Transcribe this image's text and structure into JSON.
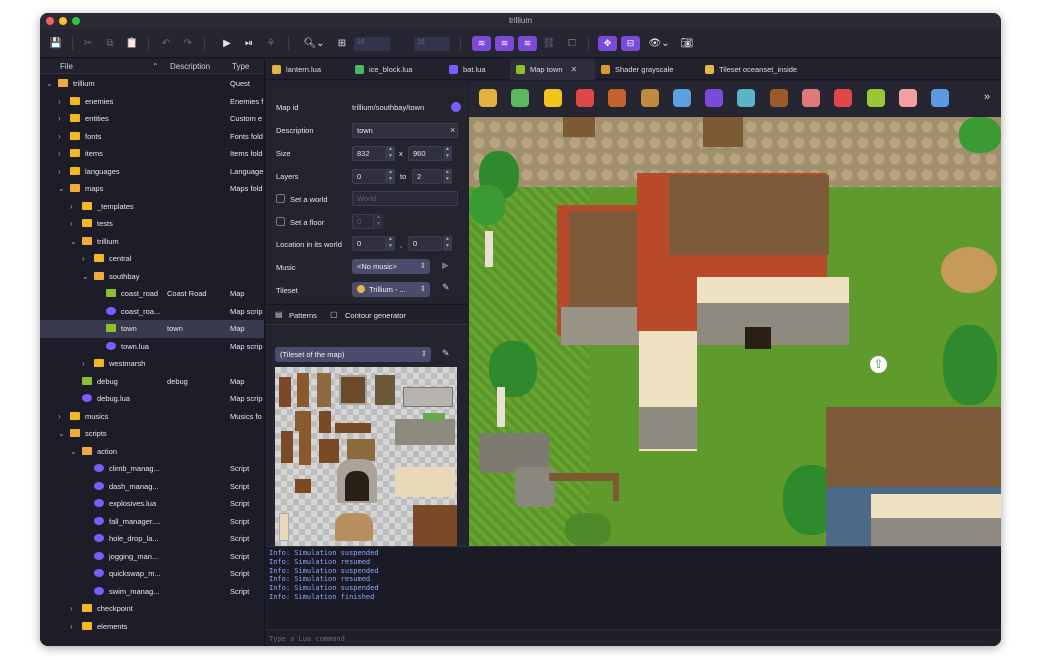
{
  "window": {
    "title": "trillium"
  },
  "toolbar": {
    "grid_w": "16",
    "grid_h": "16",
    "icons": [
      "save-icon",
      "cut-icon",
      "copy-icon",
      "paste-icon",
      "undo-icon",
      "redo-icon",
      "play-icon",
      "play-from-icon",
      "test-icon",
      "zoom-icon",
      "grid-icon",
      "layer-1-icon",
      "layer-2-icon",
      "layer-3-icon",
      "link-icon",
      "unlink-icon",
      "move-icon",
      "resize-icon",
      "view-icon",
      "screenshot-icon"
    ]
  },
  "tree": {
    "headers": {
      "file": "File",
      "description": "Description",
      "type": "Type"
    },
    "rows": [
      {
        "name": "trillium",
        "desc": "",
        "type": "Quest",
        "icon": "quest",
        "level": 0,
        "chev": "v"
      },
      {
        "name": "enemies",
        "desc": "",
        "type": "Enemies f",
        "icon": "folder",
        "level": 1,
        "chev": ">"
      },
      {
        "name": "entities",
        "desc": "",
        "type": "Custom e",
        "icon": "folder",
        "level": 1,
        "chev": ">"
      },
      {
        "name": "fonts",
        "desc": "",
        "type": "Fonts fold",
        "icon": "folder",
        "level": 1,
        "chev": ">"
      },
      {
        "name": "items",
        "desc": "",
        "type": "Items fold",
        "icon": "folder",
        "level": 1,
        "chev": ">"
      },
      {
        "name": "languages",
        "desc": "",
        "type": "Language",
        "icon": "folder",
        "level": 1,
        "chev": ">"
      },
      {
        "name": "maps",
        "desc": "",
        "type": "Maps fold",
        "icon": "folder-open",
        "level": 1,
        "chev": "v"
      },
      {
        "name": "_templates",
        "desc": "",
        "type": "",
        "icon": "folder",
        "level": 2,
        "chev": ">"
      },
      {
        "name": "tests",
        "desc": "",
        "type": "",
        "icon": "folder",
        "level": 2,
        "chev": ">"
      },
      {
        "name": "trillium",
        "desc": "",
        "type": "",
        "icon": "folder-open",
        "level": 2,
        "chev": "v"
      },
      {
        "name": "central",
        "desc": "",
        "type": "",
        "icon": "folder",
        "level": 3,
        "chev": ">"
      },
      {
        "name": "southbay",
        "desc": "",
        "type": "",
        "icon": "folder-open",
        "level": 3,
        "chev": "v"
      },
      {
        "name": "coast_road",
        "desc": "Coast Road",
        "type": "Map",
        "icon": "map",
        "level": 4,
        "chev": ""
      },
      {
        "name": "coast_roa...",
        "desc": "",
        "type": "Map scrip",
        "icon": "lua",
        "level": 4,
        "chev": ""
      },
      {
        "name": "town",
        "desc": "town",
        "type": "Map",
        "icon": "map",
        "level": 4,
        "chev": "",
        "selected": true
      },
      {
        "name": "town.lua",
        "desc": "",
        "type": "Map scrip",
        "icon": "lua",
        "level": 4,
        "chev": ""
      },
      {
        "name": "westmarsh",
        "desc": "",
        "type": "",
        "icon": "folder",
        "level": 3,
        "chev": ">"
      },
      {
        "name": "debug",
        "desc": "debug",
        "type": "Map",
        "icon": "map",
        "level": 2,
        "chev": ""
      },
      {
        "name": "debug.lua",
        "desc": "",
        "type": "Map scrip",
        "icon": "lua",
        "level": 2,
        "chev": ""
      },
      {
        "name": "musics",
        "desc": "",
        "type": "Musics fo",
        "icon": "folder",
        "level": 1,
        "chev": ">"
      },
      {
        "name": "scripts",
        "desc": "",
        "type": "",
        "icon": "folder-open",
        "level": 1,
        "chev": "v"
      },
      {
        "name": "action",
        "desc": "",
        "type": "",
        "icon": "folder-open",
        "level": 2,
        "chev": "v"
      },
      {
        "name": "climb_manag...",
        "desc": "",
        "type": "Script",
        "icon": "lua",
        "level": 3,
        "chev": ""
      },
      {
        "name": "dash_manag...",
        "desc": "",
        "type": "Script",
        "icon": "lua",
        "level": 3,
        "chev": ""
      },
      {
        "name": "explosives.lua",
        "desc": "",
        "type": "Script",
        "icon": "lua",
        "level": 3,
        "chev": ""
      },
      {
        "name": "fall_manager....",
        "desc": "",
        "type": "Script",
        "icon": "lua",
        "level": 3,
        "chev": ""
      },
      {
        "name": "hole_drop_la...",
        "desc": "",
        "type": "Script",
        "icon": "lua",
        "level": 3,
        "chev": ""
      },
      {
        "name": "jogging_man...",
        "desc": "",
        "type": "Script",
        "icon": "lua",
        "level": 3,
        "chev": ""
      },
      {
        "name": "quickswap_m...",
        "desc": "",
        "type": "Script",
        "icon": "lua",
        "level": 3,
        "chev": ""
      },
      {
        "name": "swim_manag...",
        "desc": "",
        "type": "Script",
        "icon": "lua",
        "level": 3,
        "chev": ""
      },
      {
        "name": "checkpoint",
        "desc": "",
        "type": "",
        "icon": "folder",
        "level": 2,
        "chev": ">"
      },
      {
        "name": "elements",
        "desc": "",
        "type": "",
        "icon": "folder",
        "level": 2,
        "chev": ">"
      }
    ]
  },
  "tabs": [
    {
      "label": "lantern.lua",
      "icon": "lantern-icon",
      "color": "#e3b341"
    },
    {
      "label": "ice_block.lua",
      "icon": "ice-block-icon",
      "color": "#4fb36a"
    },
    {
      "label": "bat.lua",
      "icon": "bat-icon",
      "color": "#7c5cff"
    },
    {
      "label": "Map town",
      "icon": "map-icon",
      "color": "#8fbf2f",
      "active": true,
      "closable": true
    },
    {
      "label": "Shader grayscale",
      "icon": "shader-icon",
      "color": "#d99a2b"
    },
    {
      "label": "Tileset oceanset_inside",
      "icon": "tileset-icon",
      "color": "#e8b64a"
    }
  ],
  "properties": {
    "map_id_label": "Map id",
    "map_id": "trillium/southbay/town",
    "description_label": "Description",
    "description": "town",
    "size_label": "Size",
    "size_w": "832",
    "size_x": "x",
    "size_h": "960",
    "layers_label": "Layers",
    "layers_from": "0",
    "layers_to_label": "to",
    "layers_to": "2",
    "world_label": "Set a world",
    "world_placeholder": "World",
    "floor_label": "Set a floor",
    "floor_value": "0",
    "location_label": "Location in its world",
    "location_x": "0",
    "location_sep": ",",
    "location_y": "0",
    "music_label": "Music",
    "music_value": "<No music>",
    "tileset_label": "Tileset",
    "tileset_value": "Trillium - ..."
  },
  "patterns": {
    "tab_patterns": "Patterns",
    "tab_contour": "Contour generator",
    "tileset_select": "(Tileset of the map)"
  },
  "sprites": [
    "block-icon",
    "down-arrow-icon",
    "warning-icon",
    "heart-icon",
    "pot-icon",
    "chest-icon",
    "switch-icon",
    "enemy-icon",
    "npc-icon",
    "door-icon",
    "bed-icon",
    "stop-icon",
    "question-icon",
    "mushroom-icon",
    "sign-icon"
  ],
  "console": {
    "lines": [
      "Info: Simulation suspended",
      "Info: Simulation resumed",
      "Info: Simulation suspended",
      "Info: Simulation resumed",
      "Info: Simulation suspended",
      "Info: Simulation finished"
    ],
    "placeholder": "Type a Lua command"
  }
}
